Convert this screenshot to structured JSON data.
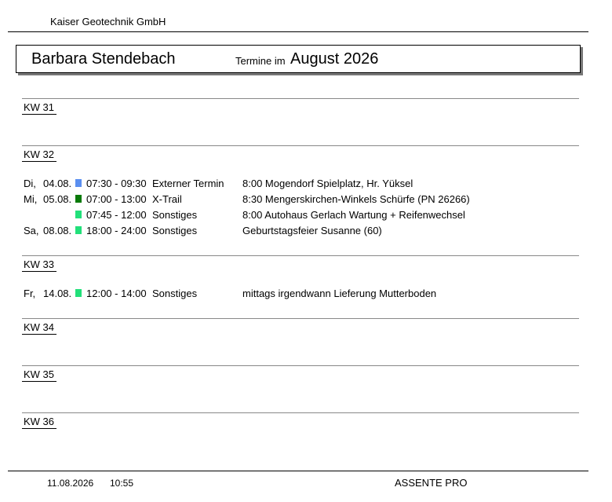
{
  "header": {
    "company": "Kaiser Geotechnik GmbH",
    "person": "Barbara Stendebach",
    "termine_label": "Termine im",
    "month": "August 2026"
  },
  "weeks": [
    {
      "label": "KW 31",
      "appointments": []
    },
    {
      "label": "KW 32",
      "appointments": [
        {
          "day": "Di,",
          "date": "04.08.",
          "color": "#5b8ff0",
          "time": "07:30 - 09:30",
          "type": "Externer Termin",
          "description": "8:00 Mogendorf Spielplatz, Hr. Yüksel"
        },
        {
          "day": "Mi,",
          "date": "05.08.",
          "color": "#0a7a0a",
          "time": "07:00 - 13:00",
          "type": "X-Trail",
          "description": "8:30 Mengerskirchen-Winkels Schürfe (PN 26266)"
        },
        {
          "day": "",
          "date": "",
          "color": "#22e07a",
          "time": "07:45 - 12:00",
          "type": "Sonstiges",
          "description": "8:00 Autohaus Gerlach Wartung + Reifenwechsel"
        },
        {
          "day": "Sa,",
          "date": "08.08.",
          "color": "#22e07a",
          "time": "18:00 - 24:00",
          "type": "Sonstiges",
          "description": "Geburtstagsfeier Susanne (60)"
        }
      ]
    },
    {
      "label": "KW 33",
      "appointments": [
        {
          "day": "Fr,",
          "date": "14.08.",
          "color": "#22e07a",
          "time": "12:00 - 14:00",
          "type": "Sonstiges",
          "description": "mittags irgendwann Lieferung Mutterboden"
        }
      ]
    },
    {
      "label": "KW 34",
      "appointments": []
    },
    {
      "label": "KW 35",
      "appointments": []
    },
    {
      "label": "KW 36",
      "appointments": []
    }
  ],
  "footer": {
    "date": "11.08.2026",
    "time": "10:55",
    "app_name": "ASSENTE PRO"
  }
}
